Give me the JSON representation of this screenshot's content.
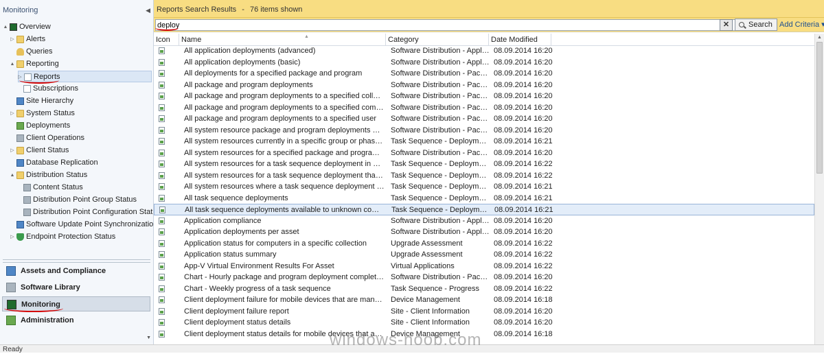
{
  "nav": {
    "header": "Monitoring",
    "tree": [
      {
        "label": "Overview",
        "indent": 0,
        "expander": "▲",
        "icon": "monitor",
        "selected": false
      },
      {
        "label": "Alerts",
        "indent": 1,
        "expander": "▷",
        "icon": "folder",
        "selected": false
      },
      {
        "label": "Queries",
        "indent": 1,
        "expander": "",
        "icon": "key",
        "selected": false
      },
      {
        "label": "Reporting",
        "indent": 1,
        "expander": "▲",
        "icon": "folder",
        "selected": false
      },
      {
        "label": "Reports",
        "indent": 2,
        "expander": "▷",
        "icon": "report",
        "selected": true
      },
      {
        "label": "Subscriptions",
        "indent": 2,
        "expander": "",
        "icon": "report",
        "selected": false
      },
      {
        "label": "Site Hierarchy",
        "indent": 1,
        "expander": "",
        "icon": "blue",
        "selected": false
      },
      {
        "label": "System Status",
        "indent": 1,
        "expander": "▷",
        "icon": "folder",
        "selected": false
      },
      {
        "label": "Deployments",
        "indent": 1,
        "expander": "",
        "icon": "green",
        "selected": false
      },
      {
        "label": "Client Operations",
        "indent": 1,
        "expander": "",
        "icon": "gray",
        "selected": false
      },
      {
        "label": "Client Status",
        "indent": 1,
        "expander": "▷",
        "icon": "folder",
        "selected": false
      },
      {
        "label": "Database Replication",
        "indent": 1,
        "expander": "",
        "icon": "blue",
        "selected": false
      },
      {
        "label": "Distribution Status",
        "indent": 1,
        "expander": "▲",
        "icon": "folder",
        "selected": false
      },
      {
        "label": "Content Status",
        "indent": 2,
        "expander": "",
        "icon": "gray",
        "selected": false
      },
      {
        "label": "Distribution Point Group Status",
        "indent": 2,
        "expander": "",
        "icon": "gray",
        "selected": false
      },
      {
        "label": "Distribution Point Configuration Status",
        "indent": 2,
        "expander": "",
        "icon": "gray",
        "selected": false
      },
      {
        "label": "Software Update Point Synchronization Status",
        "indent": 1,
        "expander": "",
        "icon": "blue",
        "selected": false
      },
      {
        "label": "Endpoint Protection Status",
        "indent": 1,
        "expander": "▷",
        "icon": "shield",
        "selected": false
      }
    ],
    "workspaces": [
      {
        "label": "Assets and Compliance",
        "icon": "blue",
        "active": false
      },
      {
        "label": "Software Library",
        "icon": "gray",
        "active": false
      },
      {
        "label": "Monitoring",
        "icon": "monitor",
        "active": true
      },
      {
        "label": "Administration",
        "icon": "green",
        "active": false
      }
    ]
  },
  "results": {
    "title": "Reports Search Results",
    "separator": "-",
    "count_text": "76 items shown"
  },
  "search": {
    "value": "deploy",
    "clear_label": "✕",
    "button_label": "Search",
    "add_criteria_label": "Add Criteria ▾"
  },
  "columns": {
    "icon": "Icon",
    "name": "Name",
    "category": "Category",
    "date": "Date Modified"
  },
  "rows": [
    {
      "name": "All application deployments (advanced)",
      "category": "Software Distribution - Applicatio...",
      "date": "08.09.2014 16:20"
    },
    {
      "name": "All application deployments (basic)",
      "category": "Software Distribution - Applicatio...",
      "date": "08.09.2014 16:20"
    },
    {
      "name": "All deployments for a specified package and program",
      "category": "Software Distribution - Package a...",
      "date": "08.09.2014 16:20"
    },
    {
      "name": "All package and program deployments",
      "category": "Software Distribution - Package a...",
      "date": "08.09.2014 16:20"
    },
    {
      "name": "All package and program deployments to a specified collection",
      "category": "Software Distribution - Package a...",
      "date": "08.09.2014 16:20"
    },
    {
      "name": "All package and program deployments to a specified computer",
      "category": "Software Distribution - Package a...",
      "date": "08.09.2014 16:20"
    },
    {
      "name": "All package and program deployments to a specified user",
      "category": "Software Distribution - Package a...",
      "date": "08.09.2014 16:20"
    },
    {
      "name": "All system resource package and program deployments with status",
      "category": "Software Distribution - Package a...",
      "date": "08.09.2014 16:20"
    },
    {
      "name": "All system resources currently in a specific group or phase of a specific...",
      "category": "Task Sequence - Deployments",
      "date": "08.09.2014 16:21"
    },
    {
      "name": "All system resources for a specified package and program deployment i...",
      "category": "Software Distribution - Package a...",
      "date": "08.09.2014 16:20"
    },
    {
      "name": "All system resources for a task sequence deployment in a specific state",
      "category": "Task Sequence - Deployment Stat...",
      "date": "08.09.2014 16:22"
    },
    {
      "name": "All system resources for a task sequence deployment that is in a specifi...",
      "category": "Task Sequence - Deployment Stat...",
      "date": "08.09.2014 16:22"
    },
    {
      "name": "All system resources where a task sequence deployment failed within a...",
      "category": "Task Sequence - Deployments",
      "date": "08.09.2014 16:21"
    },
    {
      "name": "All task sequence deployments",
      "category": "Task Sequence - Deployments",
      "date": "08.09.2014 16:21"
    },
    {
      "name": "All task sequence deployments available to unknown computers",
      "category": "Task Sequence - Deployments",
      "date": "08.09.2014 16:21"
    },
    {
      "name": "Application compliance",
      "category": "Software Distribution - Applicatio...",
      "date": "08.09.2014 16:20"
    },
    {
      "name": "Application deployments per asset",
      "category": "Software Distribution - Applicatio...",
      "date": "08.09.2014 16:20"
    },
    {
      "name": "Application status for computers in a specific collection",
      "category": "Upgrade Assessment",
      "date": "08.09.2014 16:22"
    },
    {
      "name": "Application status summary",
      "category": "Upgrade Assessment",
      "date": "08.09.2014 16:22"
    },
    {
      "name": "App-V Virtual Environment Results For Asset",
      "category": "Virtual Applications",
      "date": "08.09.2014 16:22"
    },
    {
      "name": "Chart - Hourly package and program deployment completion status",
      "category": "Software Distribution - Package a...",
      "date": "08.09.2014 16:20"
    },
    {
      "name": "Chart - Weekly progress of a task sequence",
      "category": "Task Sequence - Progress",
      "date": "08.09.2014 16:22"
    },
    {
      "name": "Client deployment failure for mobile devices that are managed by the C...",
      "category": "Device Management",
      "date": "08.09.2014 16:18"
    },
    {
      "name": "Client deployment failure report",
      "category": "Site - Client Information",
      "date": "08.09.2014 16:20"
    },
    {
      "name": "Client deployment status details",
      "category": "Site - Client Information",
      "date": "08.09.2014 16:20"
    },
    {
      "name": "Client deployment status details for mobile devices that are managed b...",
      "category": "Device Management",
      "date": "08.09.2014 16:18"
    }
  ],
  "selected_row_index": 14,
  "status": "Ready",
  "watermark": "windows-noob.com",
  "colors": {
    "header_bg": "#f8dd82",
    "selection": "#e3edf9",
    "annotation": "#d40000"
  }
}
